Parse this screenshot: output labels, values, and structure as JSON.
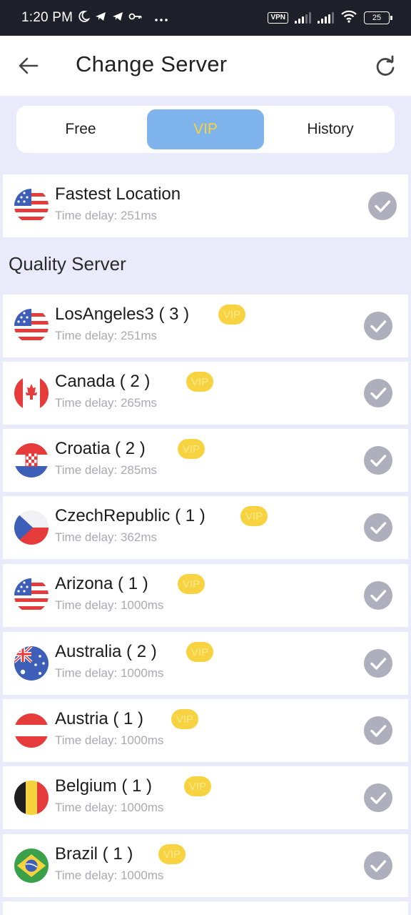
{
  "status_bar": {
    "time": "1:20 PM",
    "vpn": "VPN",
    "battery": "25"
  },
  "header": {
    "title": "Change Server",
    "back_icon": "arrow-left-icon",
    "refresh_icon": "refresh-icon"
  },
  "tabs": [
    {
      "label": "Free",
      "active": false
    },
    {
      "label": "VIP",
      "active": true
    },
    {
      "label": "History",
      "active": false
    }
  ],
  "fastest": {
    "name": "Fastest Location",
    "delay": "Time delay: 251ms",
    "flag": "us"
  },
  "section_title": "Quality Server",
  "servers": [
    {
      "name": "LosAngeles3 ( 3 )",
      "badge": "VIP",
      "delay": "Time delay: 251ms",
      "flag": "us"
    },
    {
      "name": "Canada ( 2 )",
      "badge": "VIP",
      "delay": "Time delay: 265ms",
      "flag": "ca"
    },
    {
      "name": "Croatia ( 2 )",
      "badge": "VIP",
      "delay": "Time delay: 285ms",
      "flag": "hr"
    },
    {
      "name": "CzechRepublic ( 1 )",
      "badge": "VIP",
      "delay": "Time delay: 362ms",
      "flag": "cz"
    },
    {
      "name": "Arizona ( 1 )",
      "badge": "VIP",
      "delay": "Time delay: 1000ms",
      "flag": "us"
    },
    {
      "name": "Australia ( 2 )",
      "badge": "VIP",
      "delay": "Time delay: 1000ms",
      "flag": "au"
    },
    {
      "name": "Austria ( 1 )",
      "badge": "VIP",
      "delay": "Time delay: 1000ms",
      "flag": "at"
    },
    {
      "name": "Belgium ( 1 )",
      "badge": "VIP",
      "delay": "Time delay: 1000ms",
      "flag": "be"
    },
    {
      "name": "Brazil ( 1 )",
      "badge": "VIP",
      "delay": "Time delay: 1000ms",
      "flag": "br"
    }
  ],
  "colors": {
    "vip_tab": "#7fb3ec",
    "vip_badge": "#f8d341",
    "check": "#aeaebc",
    "page_bg": "#e9ebfa"
  }
}
